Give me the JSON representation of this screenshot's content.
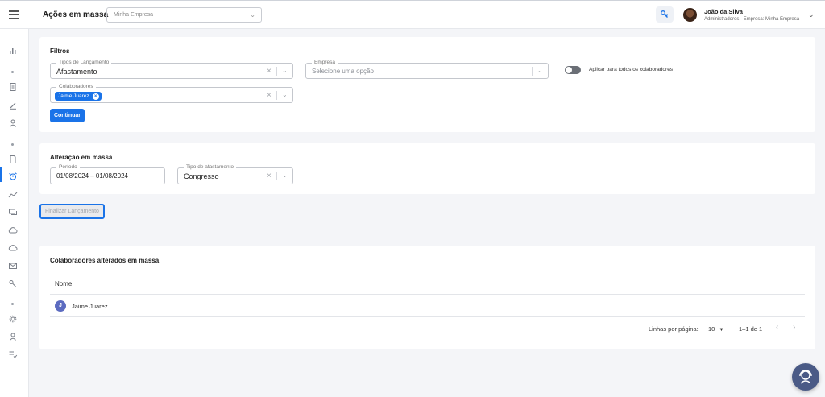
{
  "header": {
    "title": "Ações em massa",
    "company_select_value": "Minha Empresa",
    "user_name": "João da Silva",
    "user_role": "Administradores - Empresa: Minha Empresa"
  },
  "sidebar": {
    "icons": [
      "chart-icon",
      "document-icon",
      "pen-icon",
      "user-icon",
      "file-icon",
      "alarm-icon",
      "trend-icon",
      "chat-icon",
      "cloud-icon",
      "cloud-alt-icon",
      "mail-icon",
      "key-icon",
      "gear-icon",
      "person-icon",
      "checklist-icon"
    ],
    "active": "alarm-icon"
  },
  "filters": {
    "title": "Filtros",
    "tipos_label": "Tipos de Lançamento",
    "tipos_value": "Afastamento",
    "empresa_label": "Empresa",
    "empresa_placeholder": "Selecione uma opção",
    "toggle_label": "Aplicar para todos os colaboradores",
    "toggle_on": false,
    "colaboradores_label": "Colaboradores",
    "colaboradores_chips": [
      "Jaime Juarez"
    ],
    "continue_label": "Continuar"
  },
  "alteracao": {
    "title": "Alteração em massa",
    "periodo_label": "Período",
    "periodo_value": "01/08/2024 – 01/08/2024",
    "tipo_label": "Tipo de afastamento",
    "tipo_value": "Congresso"
  },
  "finalize_label": "Finalizar Lançamento",
  "results": {
    "title": "Colaboradores alterados em massa",
    "column_nome": "Nome",
    "rows": [
      {
        "initial": "J",
        "name": "Jaime Juarez"
      }
    ],
    "rows_per_page_label": "Linhas por página:",
    "rows_per_page_value": "10",
    "range": "1–1 de 1"
  },
  "colors": {
    "primary": "#1a73e8",
    "avatar": "#5c6bc0",
    "fab": "#4a5a86"
  }
}
